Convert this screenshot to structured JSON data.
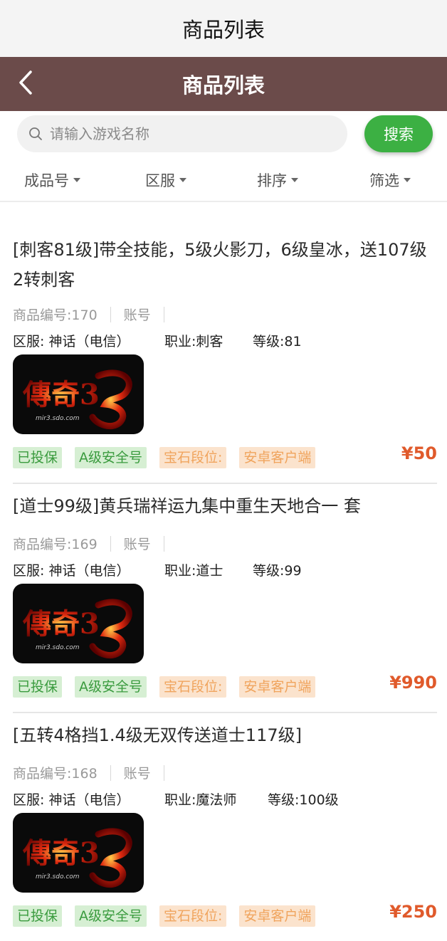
{
  "status_title": "商品列表",
  "navbar": {
    "title": "商品列表",
    "back_icon": "chevron-left-icon"
  },
  "search": {
    "placeholder": "请输入游戏名称",
    "value": "",
    "button_label": "搜索",
    "icon": "search-icon"
  },
  "filters": [
    "成品号",
    "区服",
    "排序",
    "筛选"
  ],
  "colors": {
    "navbar": "#6b4b4a",
    "accent_green": "#3cb043",
    "price": "#e05a2b",
    "tag_green_bg": "#d6efd3",
    "tag_orange_bg": "#fbe3cd"
  },
  "products": [
    {
      "title": "[刺客81级]带全技能，5级火影刀，6级皇冰，送107级2转刺客",
      "code": "商品编号:170",
      "account": "账号",
      "server": "区服: 神话（电信）",
      "profession": "职业:刺客",
      "level": "等级:81",
      "image_label": "傳奇3",
      "image_sub": "mir3.sdo.com",
      "tags": [
        "已投保",
        "A级安全号",
        "宝石段位:",
        "安卓客户端"
      ],
      "price": "¥50"
    },
    {
      "title": "[道士99级]黄兵瑞祥运九集中重生天地合一 套",
      "code": "商品编号:169",
      "account": "账号",
      "server": "区服: 神话（电信）",
      "profession": "职业:道士",
      "level": "等级:99",
      "image_label": "傳奇3",
      "image_sub": "mir3.sdo.com",
      "tags": [
        "已投保",
        "A级安全号",
        "宝石段位:",
        "安卓客户端"
      ],
      "price": "¥990"
    },
    {
      "title": "[五转4格挡1.4级无双传送道士117级]",
      "code": "商品编号:168",
      "account": "账号",
      "server": "区服: 神话（电信）",
      "profession": "职业:魔法师",
      "level": "等级:100级",
      "image_label": "傳奇3",
      "image_sub": "mir3.sdo.com",
      "tags": [
        "已投保",
        "A级安全号",
        "宝石段位:",
        "安卓客户端"
      ],
      "price": "¥250"
    }
  ]
}
